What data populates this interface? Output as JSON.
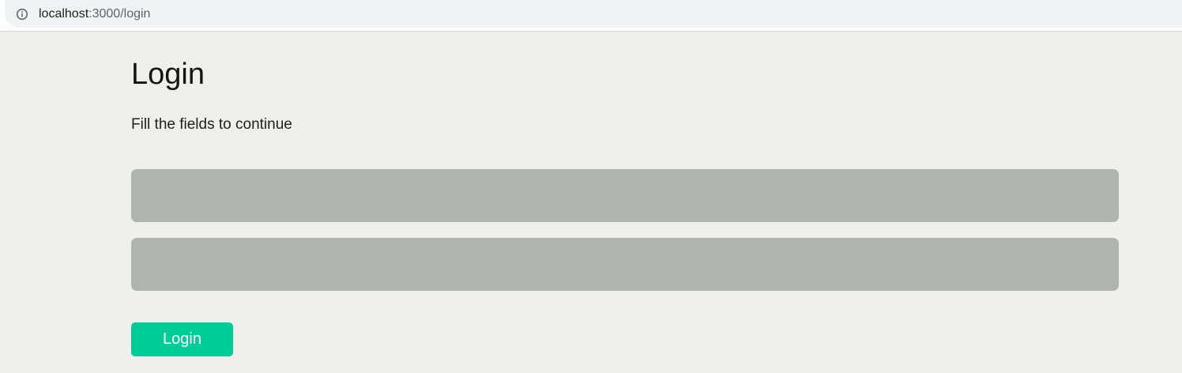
{
  "browser": {
    "url_host": "localhost",
    "url_rest": ":3000/login",
    "info_icon": "info-circle-icon"
  },
  "page": {
    "title": "Login",
    "subtitle": "Fill the fields to continue",
    "username_field": {
      "value": "",
      "placeholder": ""
    },
    "password_field": {
      "value": "",
      "placeholder": ""
    },
    "login_button_label": "Login"
  },
  "colors": {
    "background": "#eff0ed",
    "field": "#b1b3b0",
    "accent": "#00cc98"
  }
}
